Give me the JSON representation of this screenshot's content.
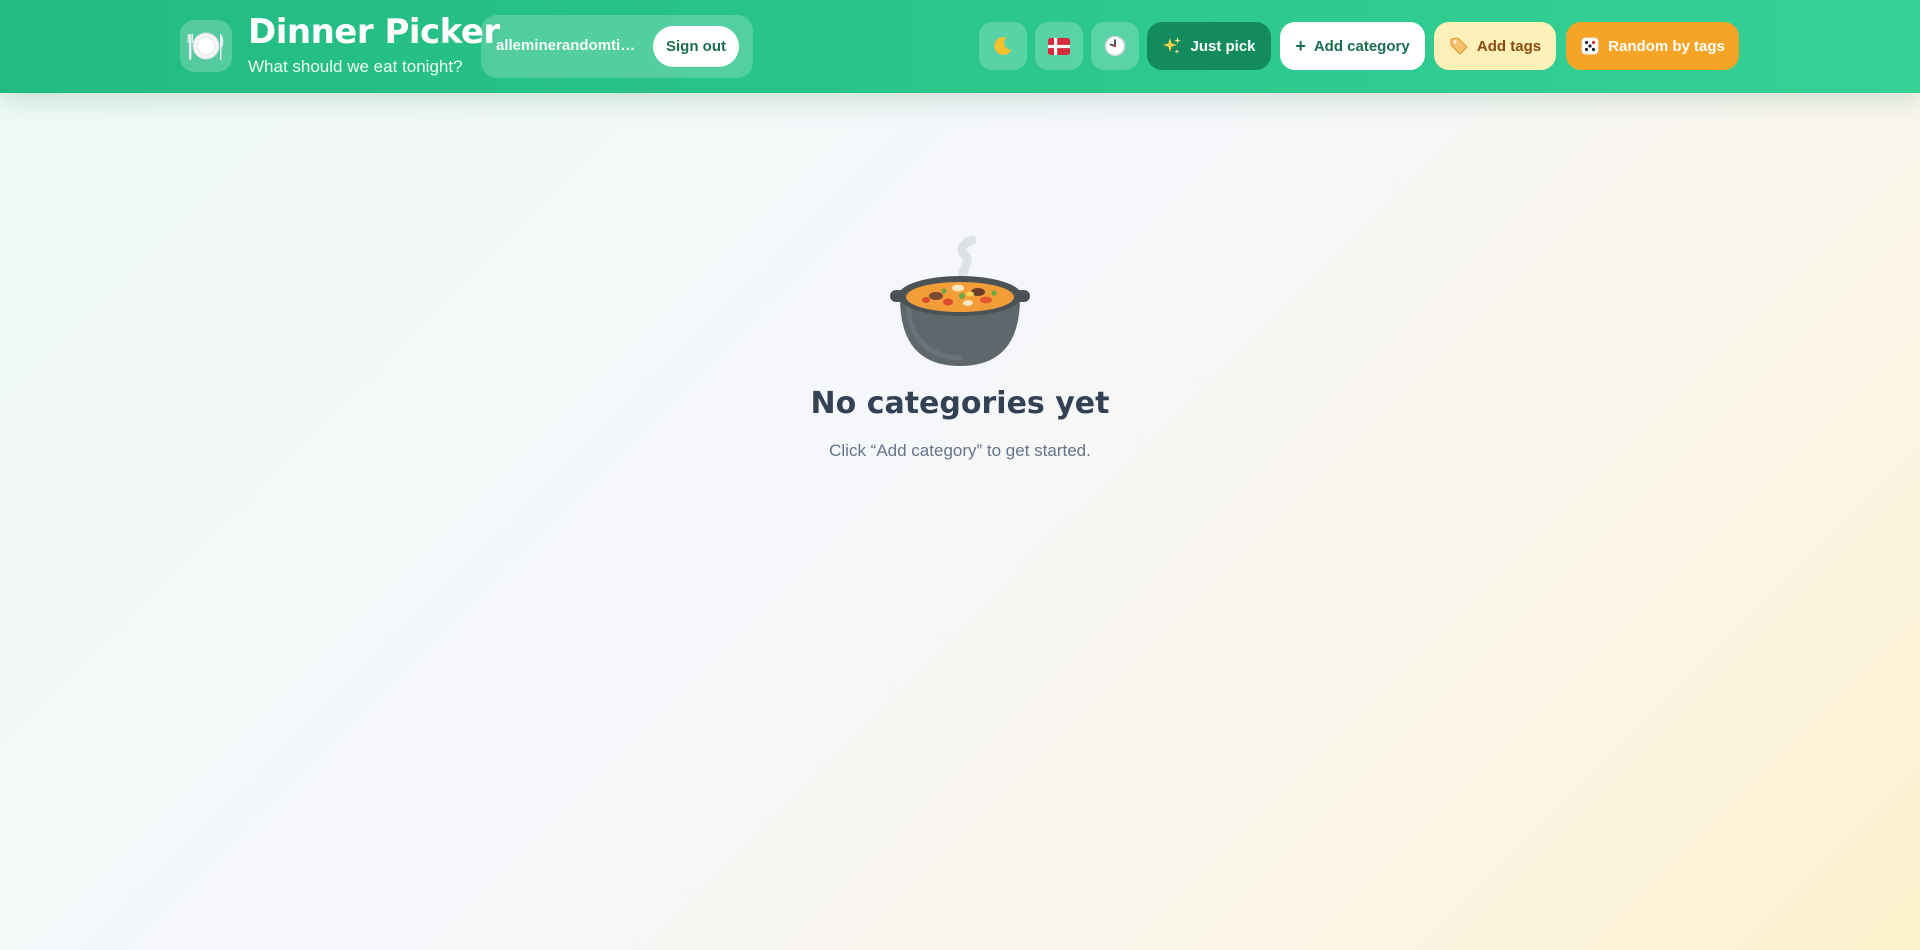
{
  "app": {
    "title": "Dinner Picker",
    "subtitle": "What should we eat tonight?"
  },
  "account": {
    "email": "alleminerandomtin…",
    "sign_out_label": "Sign out"
  },
  "toolbar": {
    "theme_icon": "moon-icon",
    "language_icon": "denmark-flag-icon",
    "history_icon": "clock-icon",
    "just_pick_label": "Just pick",
    "add_category_label": "Add category",
    "add_tags_label": "Add tags",
    "random_by_tags_label": "Random by tags"
  },
  "empty_state": {
    "icon": "pot-of-food-icon",
    "title": "No categories yet",
    "message": "Click “Add category” to get started."
  },
  "colors": {
    "header": "#22bb83",
    "just_pick": "#148a5f",
    "add_tags": "#fdf0b9",
    "random_by_tags": "#f5a425"
  }
}
